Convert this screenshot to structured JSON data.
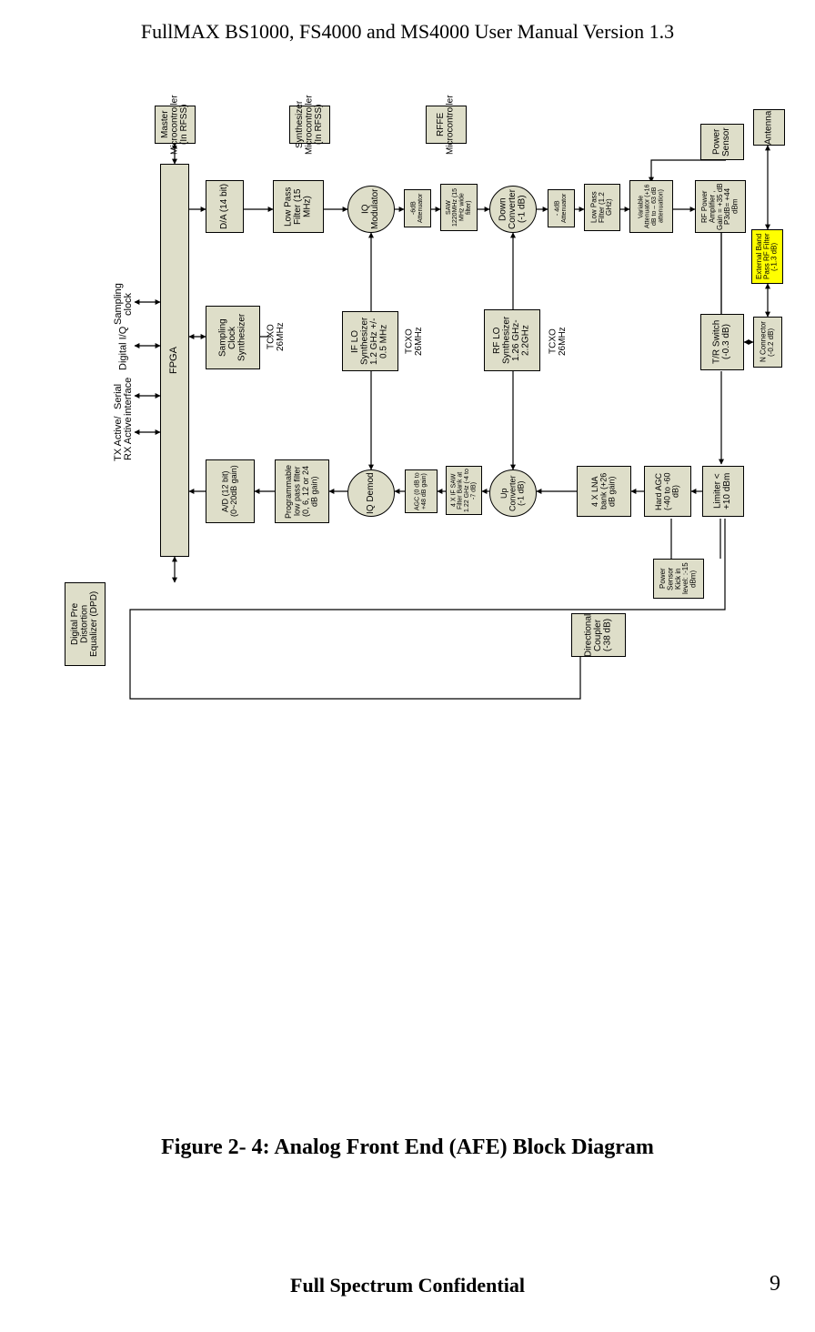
{
  "header": "FullMAX BS1000, FS4000 and MS4000 User Manual Version 1.3",
  "caption": "Figure 2- 4: Analog Front End (AFE) Block Diagram",
  "footer": "Full Spectrum Confidential",
  "page_number": "9",
  "labels": {
    "sampling_clock": "Sampling\nclock",
    "digital_iq": "Digital I/Q",
    "serial_interface": "Serial\ninterface",
    "txrx_active": "TX Active/\nRX Active",
    "tcxo1": "TCXO\n26MHz",
    "tcxo2": "TCXO\n26MHz",
    "tcxo3": "TCXO\n26MHz"
  },
  "blocks": {
    "fpga": "FPGA",
    "master_mcu": "Master\nMicrocontroller\n(In RFSS)",
    "synth_mcu": "Synthesizer\nMicrocontroller\n(In RFSS)",
    "rffe_mcu": "RFFE\nMicrocontroller",
    "dpd": "Digital Pre\nDistortion\nEqualizer (DPD)",
    "da": "D/A\n(14 bit)",
    "lpf15": "Low Pass\nFilter (15\nMHz)",
    "iq_mod": "IQ\nModulator",
    "atten6": "-6dB\nAttenuator",
    "saw_1220": "SAW\n1220MHz\n(15 MHz\nwide filter)",
    "down_conv": "Down\nConverter\n(-1 dB)",
    "atten4": "- 4dB\nAttenuator",
    "lpf12": "Low Pass\nFilter (1.2\nGHz)",
    "var_atten": "Variable\nAttenuator\n(+16  dB to –\n63 dB\nattenuation)",
    "rf_pa": "RF Power\nAmplifier ,\nGain = +35 dB\nP3dB= +44 dBm",
    "ext_bpf": "External\nBand Pass\nRF Filter\n(-1.3 dB)",
    "n_conn": "N\nConnector\n(-0.2 dB)",
    "power_sensor": "Power\nSensor",
    "antenna": "Antenna",
    "samp_clk_synth": "Sampling\nClock\nSynthesizer",
    "if_lo": "IF LO\nSynthesizer\n1.2 GHz +/-\n0.5 MHz",
    "rf_lo": "RF LO\nSynthesizer\n1.26 GHz-\n2.2GHz",
    "ad": "A/D\n(12 bit)\n(0~20dB\ngain)",
    "prog_lpf": "Programmable\nlow pass filter\n(0, 6, 12 or 24\ndB gain)",
    "iq_demod": "IQ\nDemod",
    "agc": "AGC\n(0 dB to +48\ndB gain)",
    "if_saw_bank": "4 X IF SAW\nFilter Bank\nat 1.22 GHz\n(-4 to -7 dB)",
    "up_conv": "Up Converter\n(-1 dB)",
    "lna_bank": "4 X LNA bank\n(+26 dB gain)",
    "hard_agc": "Hard AGC (-40\nto -60 dB)",
    "limiter": "Limiter\n< +10\ndBm",
    "tr_switch": "T/R\nSwitch\n(-0.3 dB)",
    "power_sensor_rx": "Power Sensor\nKick in level:\n:-15 dBm)",
    "dir_coupler": "Directional\nCoupler\n(-38 dB)"
  }
}
